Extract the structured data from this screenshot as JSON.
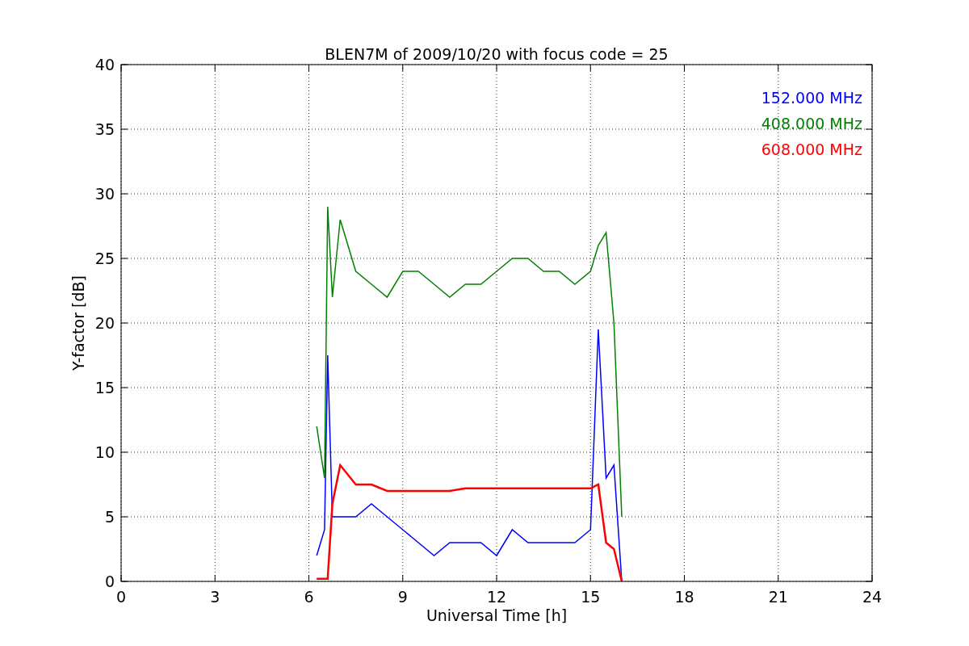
{
  "chart_data": {
    "type": "line",
    "title": "BLEN7M of 2009/10/20 with focus code = 25",
    "xlabel": "Universal Time [h]",
    "ylabel": "Y-factor [dB]",
    "grid": true,
    "x": [
      6.25,
      6.5,
      6.6,
      6.75,
      7,
      7.5,
      8,
      8.5,
      9,
      9.5,
      10,
      10.5,
      11,
      11.5,
      12,
      12.5,
      13,
      13.5,
      14,
      14.5,
      15,
      15.25,
      15.5,
      15.75,
      16
    ],
    "series": [
      {
        "name": "152.000 MHz",
        "color": "#0000ff",
        "values": [
          2,
          4,
          17.5,
          5,
          5,
          5,
          6,
          5,
          4,
          3,
          2,
          3,
          3,
          3,
          2,
          4,
          3,
          3,
          3,
          3,
          4,
          19.5,
          8,
          9,
          0
        ]
      },
      {
        "name": "408.000 MHz",
        "color": "#008000",
        "values": [
          12,
          8,
          29,
          22,
          28,
          24,
          23,
          22,
          24,
          24,
          23,
          22,
          23,
          23,
          24,
          25,
          25,
          24,
          24,
          23,
          24,
          26,
          27,
          20,
          5
        ]
      },
      {
        "name": "608.000 MHz",
        "color": "#ff0000",
        "values": [
          0.2,
          0.2,
          0.2,
          6,
          9,
          7.5,
          7.5,
          7,
          7,
          7,
          7,
          7,
          7.2,
          7.2,
          7.2,
          7.2,
          7.2,
          7.2,
          7.2,
          7.2,
          7.2,
          7.5,
          3,
          2.5,
          0
        ]
      }
    ],
    "xlim": [
      0,
      24
    ],
    "ylim": [
      0,
      40
    ],
    "xticks": [
      0,
      3,
      6,
      9,
      12,
      15,
      18,
      21,
      24
    ],
    "yticks": [
      0,
      5,
      10,
      15,
      20,
      25,
      30,
      35,
      40
    ]
  }
}
